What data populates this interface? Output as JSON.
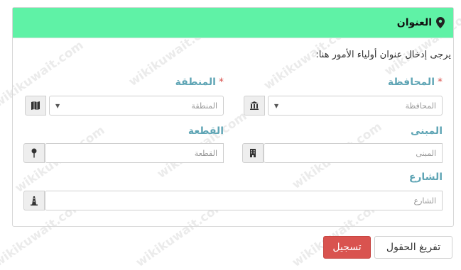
{
  "panel": {
    "title": "العنوان",
    "note": "يرجى إدخال عنوان أولياء الأمور هنا:"
  },
  "fields": {
    "governorate": {
      "label": "المحافظة",
      "placeholder": "المحافظة",
      "required_mark": "*"
    },
    "area": {
      "label": "المنطقة",
      "placeholder": "المنطقة",
      "required_mark": "*"
    },
    "building": {
      "label": "المبنى",
      "placeholder": "المبنى"
    },
    "block": {
      "label": "القطعة",
      "placeholder": "القطعة"
    },
    "street": {
      "label": "الشارع",
      "placeholder": "الشارع"
    }
  },
  "buttons": {
    "clear": "تفريغ الحقول",
    "save": "تسجيل"
  },
  "watermark": "wikikuwait.com",
  "colors": {
    "header_bg": "#5ff2a6",
    "label": "#5fa5b5",
    "save_btn": "#d9534f"
  }
}
